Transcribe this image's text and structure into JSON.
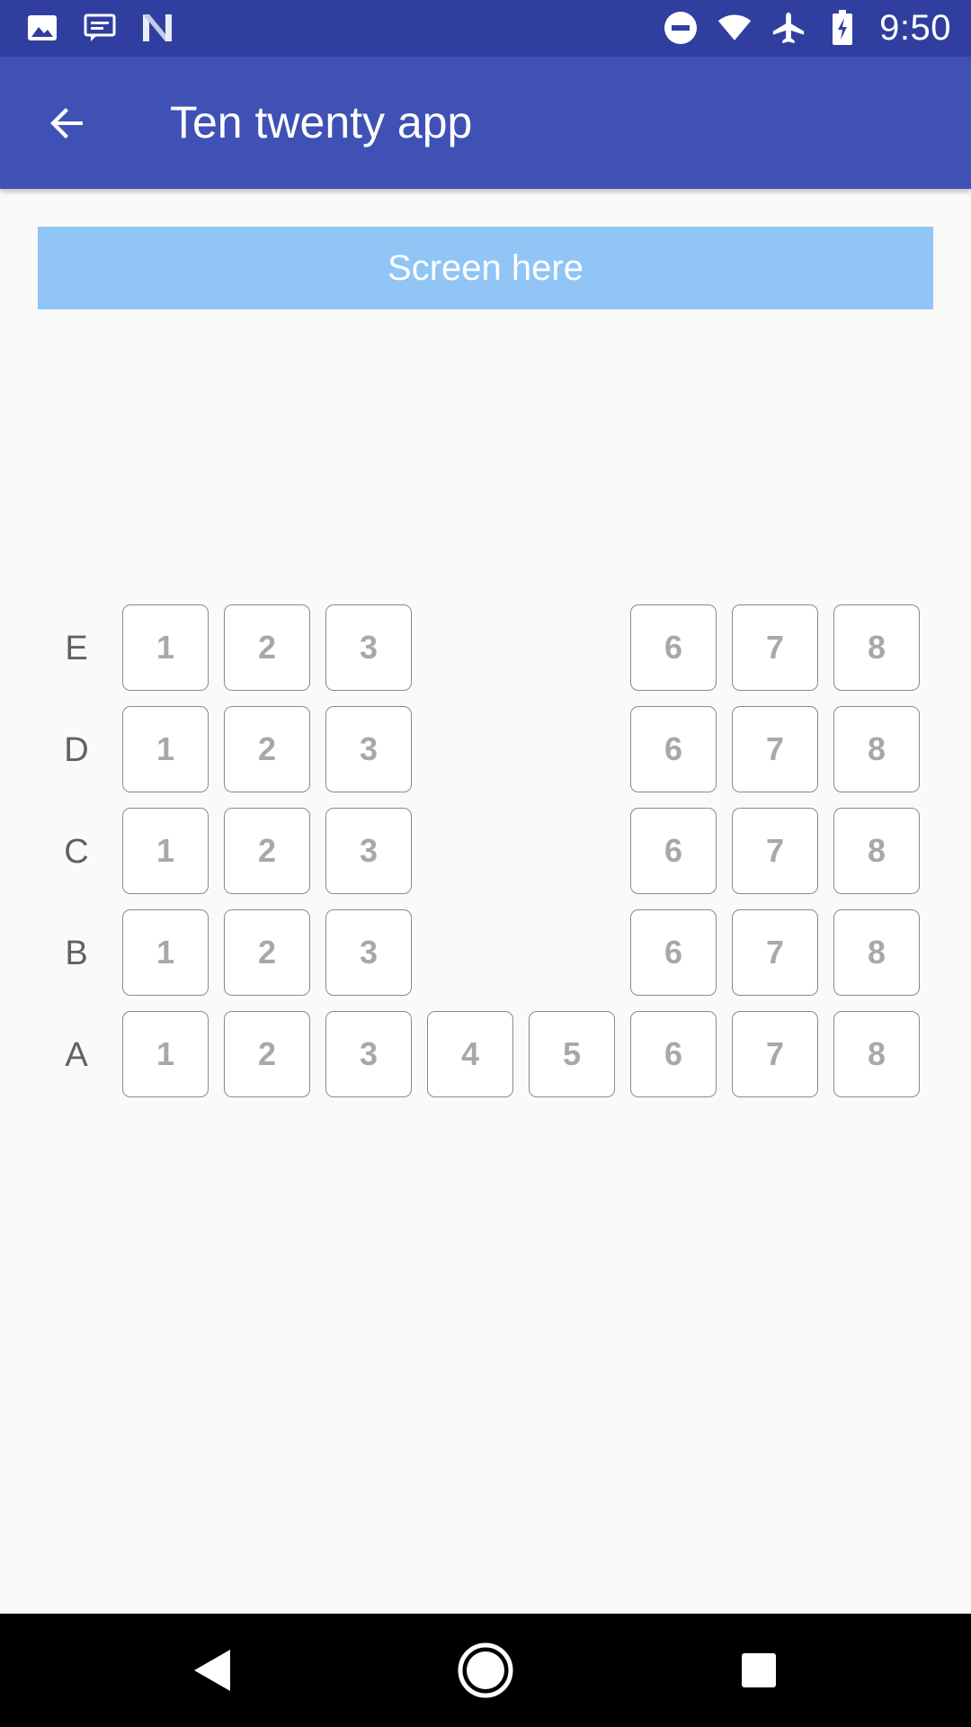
{
  "status_bar": {
    "time": "9:50",
    "left_icons": [
      "image-icon",
      "message-icon",
      "n-logo-icon"
    ],
    "right_icons": [
      "do-not-disturb-icon",
      "wifi-icon",
      "airplane-icon",
      "battery-charging-icon"
    ]
  },
  "app_bar": {
    "title": "Ten twenty app",
    "back_icon": "arrow-back-icon"
  },
  "screen": {
    "label": "Screen here"
  },
  "seats": {
    "rows": [
      {
        "label": "E",
        "seats": [
          "1",
          "2",
          "3",
          "6",
          "7",
          "8"
        ]
      },
      {
        "label": "D",
        "seats": [
          "1",
          "2",
          "3",
          "6",
          "7",
          "8"
        ]
      },
      {
        "label": "C",
        "seats": [
          "1",
          "2",
          "3",
          "6",
          "7",
          "8"
        ]
      },
      {
        "label": "B",
        "seats": [
          "1",
          "2",
          "3",
          "6",
          "7",
          "8"
        ]
      },
      {
        "label": "A",
        "seats": [
          "1",
          "2",
          "3",
          "4",
          "5",
          "6",
          "7",
          "8"
        ]
      }
    ]
  },
  "nav_bar": {
    "icons": [
      "back-triangle-icon",
      "home-circle-icon",
      "recents-square-icon"
    ]
  },
  "colors": {
    "status_bar": "#303f9f",
    "app_bar": "#3f51b5",
    "screen_bar": "#90c5f5",
    "background": "#fafafa"
  }
}
